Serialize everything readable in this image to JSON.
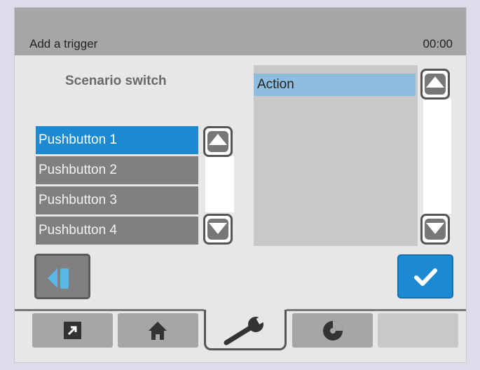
{
  "header": {
    "title": "Add a trigger",
    "clock": "00:00"
  },
  "left_panel": {
    "title": "Scenario switch",
    "items": [
      "Pushbutton 1",
      "Pushbutton 2",
      "Pushbutton 3",
      "Pushbutton 4"
    ],
    "selected_index": 0
  },
  "right_panel": {
    "items": [
      "Action"
    ],
    "selected_index": 0
  },
  "tabs": [
    {
      "icon": "external-link-icon"
    },
    {
      "icon": "home-icon"
    },
    {
      "icon": "wrench-icon",
      "active": true
    },
    {
      "icon": "disc-icon"
    },
    {
      "icon": ""
    }
  ],
  "colors": {
    "accent": "#1b8ad3",
    "selected_action": "#8fbde0",
    "title_bar": "#a6a6a6",
    "list_item": "#808080"
  }
}
